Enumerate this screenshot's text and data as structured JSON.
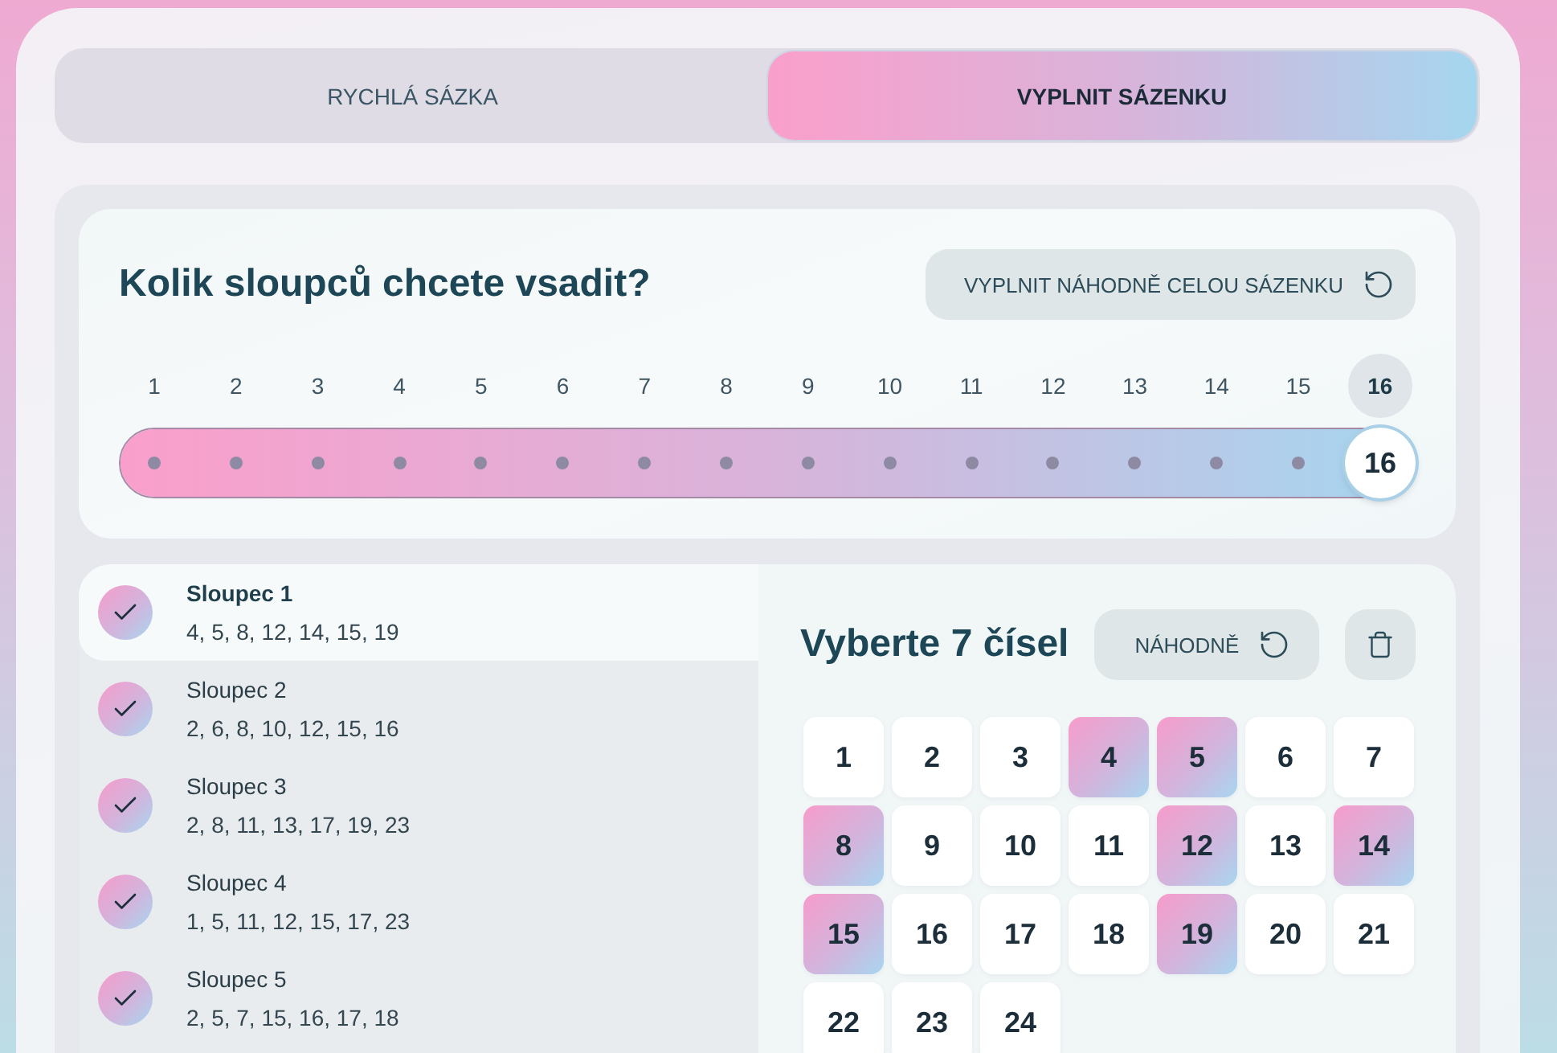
{
  "tabs": [
    {
      "label": "RYCHLÁ SÁZKA",
      "selected": false
    },
    {
      "label": "VYPLNIT SÁZENKU",
      "selected": true
    }
  ],
  "column_count": {
    "title": "Kolik sloupců chcete vsadit?",
    "fill_button": {
      "label": "VYPLNIT NÁHODNĚ CELOU SÁZENKU"
    },
    "ticks": [
      {
        "label": "1",
        "selected": false
      },
      {
        "label": "2",
        "selected": false
      },
      {
        "label": "3",
        "selected": false
      },
      {
        "label": "4",
        "selected": false
      },
      {
        "label": "5",
        "selected": false
      },
      {
        "label": "6",
        "selected": false
      },
      {
        "label": "7",
        "selected": false
      },
      {
        "label": "8",
        "selected": false
      },
      {
        "label": "9",
        "selected": false
      },
      {
        "label": "10",
        "selected": false
      },
      {
        "label": "11",
        "selected": false
      },
      {
        "label": "12",
        "selected": false
      },
      {
        "label": "13",
        "selected": false
      },
      {
        "label": "14",
        "selected": false
      },
      {
        "label": "15",
        "selected": false
      },
      {
        "label": "16",
        "selected": true
      }
    ],
    "slider": {
      "level": 1,
      "value": "16"
    }
  },
  "columns": [
    {
      "title": "Sloupec 1",
      "numbers": "4, 5, 8, 12, 14, 15, 19",
      "checked": true,
      "selected": true
    },
    {
      "title": "Sloupec 2",
      "numbers": "2, 6, 8, 10, 12, 15, 16",
      "checked": true,
      "selected": false
    },
    {
      "title": "Sloupec 3",
      "numbers": "2, 8, 11, 13, 17, 19, 23",
      "checked": true,
      "selected": false
    },
    {
      "title": "Sloupec 4",
      "numbers": "1, 5, 11, 12, 15, 17, 23",
      "checked": true,
      "selected": false
    },
    {
      "title": "Sloupec 5",
      "numbers": "2, 5, 7, 15, 16, 17, 18",
      "checked": true,
      "selected": false
    }
  ],
  "number_picker": {
    "title": "Vyberte 7 čísel",
    "random_button": {
      "label": "NÁHODNĚ"
    },
    "numbers": [
      {
        "label": "1",
        "selected": false
      },
      {
        "label": "2",
        "selected": false
      },
      {
        "label": "3",
        "selected": false
      },
      {
        "label": "4",
        "selected": true
      },
      {
        "label": "5",
        "selected": true
      },
      {
        "label": "6",
        "selected": false
      },
      {
        "label": "7",
        "selected": false
      },
      {
        "label": "8",
        "selected": true
      },
      {
        "label": "9",
        "selected": false
      },
      {
        "label": "10",
        "selected": false
      },
      {
        "label": "11",
        "selected": false
      },
      {
        "label": "12",
        "selected": true
      },
      {
        "label": "13",
        "selected": false
      },
      {
        "label": "14",
        "selected": true
      },
      {
        "label": "15",
        "selected": true
      },
      {
        "label": "16",
        "selected": false
      },
      {
        "label": "17",
        "selected": false
      },
      {
        "label": "18",
        "selected": false
      },
      {
        "label": "19",
        "selected": true
      },
      {
        "label": "20",
        "selected": false
      },
      {
        "label": "21",
        "selected": false
      },
      {
        "label": "22",
        "selected": false
      },
      {
        "label": "23",
        "selected": false
      },
      {
        "label": "24",
        "selected": false
      }
    ]
  }
}
